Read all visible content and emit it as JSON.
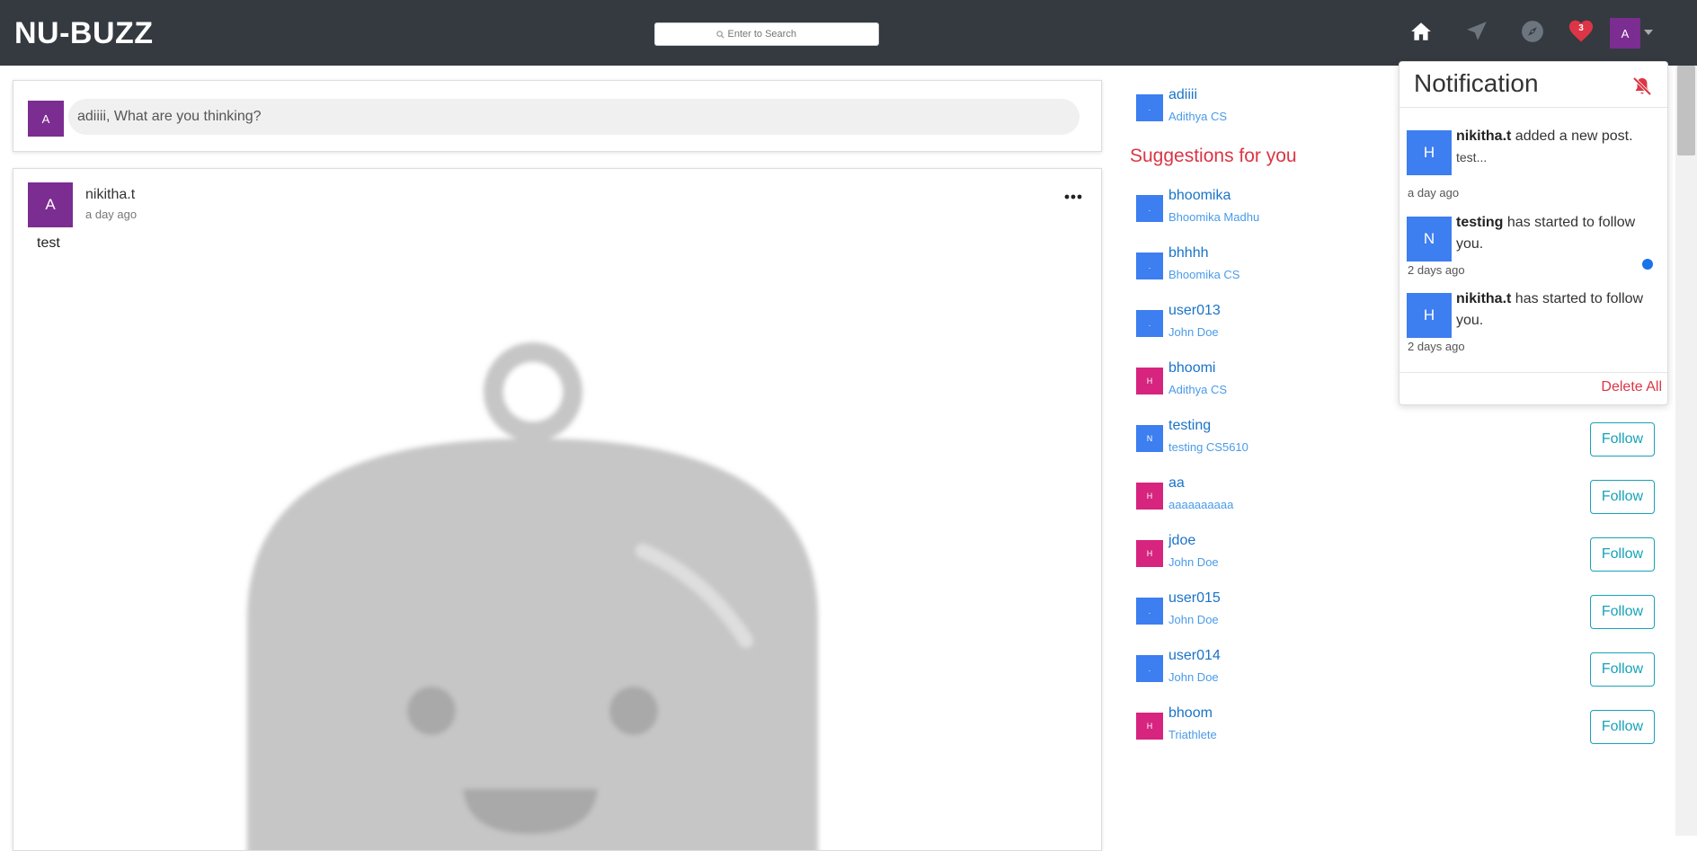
{
  "header": {
    "brand": "NU-BUZZ",
    "search_placeholder": "Enter to Search",
    "icons": [
      "home-icon",
      "send-icon",
      "compass-icon",
      "heart-icon"
    ],
    "heart_badge": "3",
    "avatar_letter": "A"
  },
  "composer": {
    "avatar_letter": "A",
    "prompt": "adiiii, What are you thinking?"
  },
  "post": {
    "avatar_letter": "A",
    "author": "nikitha.t",
    "time": "a day ago",
    "text": "test"
  },
  "sidebar": {
    "me": {
      "username": "adiiii",
      "full_name": "Adithya CS",
      "avatar_letter": "."
    },
    "suggestions_title": "Suggestions for you",
    "follow_label": "Follow",
    "suggestions": [
      {
        "username": "bhoomika",
        "full_name": "Bhoomika Madhu",
        "avatar_letter": ".",
        "avatar_color": "#3d7ef0"
      },
      {
        "username": "bhhhh",
        "full_name": "Bhoomika CS",
        "avatar_letter": ".",
        "avatar_color": "#3d7ef0"
      },
      {
        "username": "user013",
        "full_name": "John Doe",
        "avatar_letter": ".",
        "avatar_color": "#3d7ef0"
      },
      {
        "username": "bhoomi",
        "full_name": "Adithya CS",
        "avatar_letter": "H",
        "avatar_color": "#d6247f"
      },
      {
        "username": "testing",
        "full_name": "testing CS5610",
        "avatar_letter": "N",
        "avatar_color": "#3d7ef0"
      },
      {
        "username": "aa",
        "full_name": "aaaaaaaaaa",
        "avatar_letter": "H",
        "avatar_color": "#d6247f"
      },
      {
        "username": "jdoe",
        "full_name": "John Doe",
        "avatar_letter": "H",
        "avatar_color": "#d6247f"
      },
      {
        "username": "user015",
        "full_name": "John Doe",
        "avatar_letter": ".",
        "avatar_color": "#3d7ef0"
      },
      {
        "username": "user014",
        "full_name": "John Doe",
        "avatar_letter": ".",
        "avatar_color": "#3d7ef0"
      },
      {
        "username": "bhoom",
        "full_name": "Triathlete",
        "avatar_letter": "H",
        "avatar_color": "#d6247f"
      }
    ]
  },
  "notifications": {
    "title": "Notification",
    "delete_all": "Delete All",
    "items": [
      {
        "avatar_letter": "H",
        "actor": "nikitha.t",
        "message": " added a new post.",
        "snippet": "test...",
        "time": "a day ago",
        "unread": false
      },
      {
        "avatar_letter": "N",
        "actor": "testing",
        "message": " has started to follow you.",
        "snippet": "",
        "time": "2 days ago",
        "unread": true
      },
      {
        "avatar_letter": "H",
        "actor": "nikitha.t",
        "message": " has started to follow you.",
        "snippet": "",
        "time": "2 days ago",
        "unread": false
      }
    ]
  },
  "colors": {
    "navbar": "#343a40",
    "avatar_purple": "#7b2d91",
    "avatar_blue": "#3d7ef0",
    "avatar_pink": "#d6247f",
    "link_blue": "#1a73c8",
    "danger": "#dc3545",
    "follow_teal": "#17a2b8"
  }
}
